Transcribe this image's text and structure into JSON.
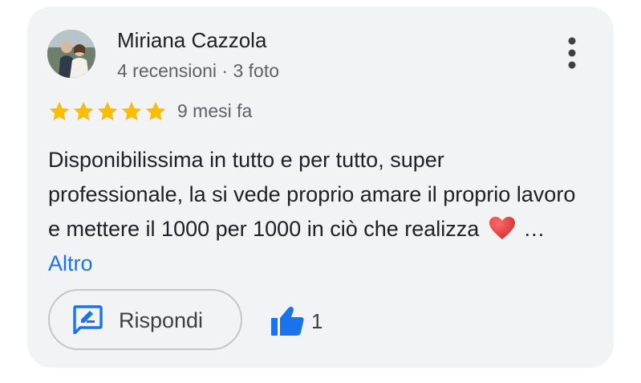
{
  "review": {
    "author": {
      "name": "Miriana Cazzola",
      "reviews_count": "4 recensioni",
      "separator": "·",
      "photos_count": "3 foto",
      "meta_line": "4 recensioni · 3 foto"
    },
    "rating": 5,
    "rating_max": 5,
    "date": "9 mesi fa",
    "text_before_emoji": "Disponibilissima in tutto e per tutto, super professionale, la si vede proprio amare il proprio lavoro e mettere il 1000 per 1000 in ciò che realizza",
    "emoji": "heart-emoji",
    "ellipsis": "…",
    "more_label": "Altro",
    "actions": {
      "reply_label": "Rispondi",
      "like_count": "1"
    }
  },
  "icons": {
    "menu": "more-vert-icon",
    "star": "star-icon",
    "reply": "rate-review-icon",
    "like": "thumb-up-icon"
  },
  "colors": {
    "card_background": "#f1f3f4",
    "star": "#fbbc04",
    "link": "#1a73e8",
    "primary_text": "#202124",
    "secondary_text": "#5f6368",
    "reply_icon": "#1a73e8",
    "like_icon": "#1a73e8",
    "heart": "#e53935"
  }
}
